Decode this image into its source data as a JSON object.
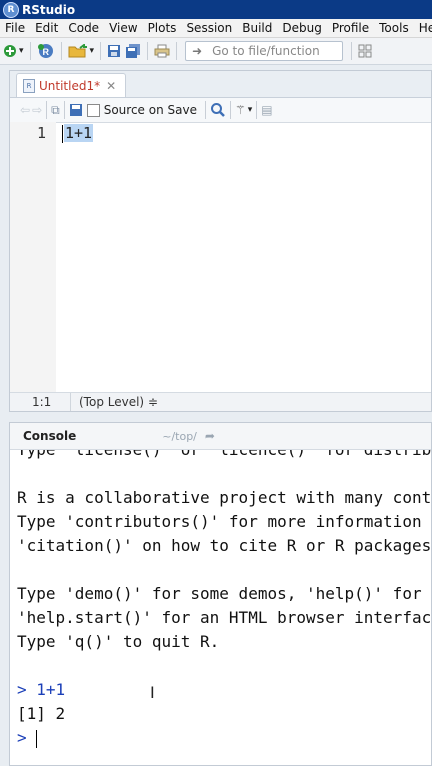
{
  "window": {
    "title": "RStudio",
    "app_icon": "R"
  },
  "menu": [
    "File",
    "Edit",
    "Code",
    "View",
    "Plots",
    "Session",
    "Build",
    "Debug",
    "Profile",
    "Tools",
    "Help"
  ],
  "toolbar": {
    "goto_placeholder": "Go to file/function"
  },
  "editor": {
    "tab_name": "Untitled1*",
    "source_on_save": "Source on Save",
    "code_lines": [
      {
        "num": "1",
        "text": "1+1"
      }
    ],
    "status_position": "1:1",
    "status_scope": "(Top Level) ≑"
  },
  "console": {
    "label": "Console",
    "path": "~/top/",
    "lines": [
      {
        "kind": "cut",
        "text": "Type 'license()' or 'licence()' for distribution details."
      },
      {
        "kind": "out",
        "text": ""
      },
      {
        "kind": "out",
        "text": "R is a collaborative project with many contributors."
      },
      {
        "kind": "out",
        "text": "Type 'contributors()' for more information and"
      },
      {
        "kind": "out",
        "text": "'citation()' on how to cite R or R packages in publications."
      },
      {
        "kind": "out",
        "text": ""
      },
      {
        "kind": "out",
        "text": "Type 'demo()' for some demos, 'help()' for on-line help, or"
      },
      {
        "kind": "out",
        "text": "'help.start()' for an HTML browser interface to help."
      },
      {
        "kind": "out",
        "text": "Type 'q()' to quit R."
      },
      {
        "kind": "out",
        "text": ""
      },
      {
        "kind": "in",
        "prompt": ">",
        "text": "1+1"
      },
      {
        "kind": "out",
        "text": "[1] 2"
      },
      {
        "kind": "prompt",
        "prompt": ">",
        "text": ""
      }
    ]
  },
  "icons": {
    "new": "plus-circle-icon",
    "open": "folder-open-icon",
    "save": "floppy-icon",
    "save_all": "floppy-multi-icon",
    "print": "printer-icon",
    "search": "magnifier-icon",
    "wand": "magic-wand-icon",
    "layout": "pane-layout-icon"
  },
  "colors": {
    "titlebar": "#0b3a86",
    "prompt": "#1b3fb8",
    "tab_modified": "#c0392b",
    "selection": "#b9d5f3"
  }
}
